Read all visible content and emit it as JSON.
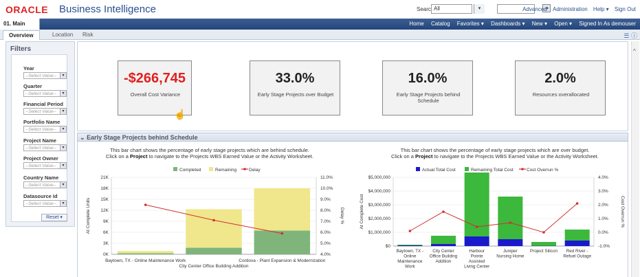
{
  "header": {
    "brand": "ORACLE",
    "product": "Business Intelligence",
    "search_label": "Search",
    "search_scope": "All",
    "links": [
      "Advanced",
      "Administration",
      "Help ▾",
      "Sign Out"
    ]
  },
  "nav": {
    "tab": "01. Main",
    "links": [
      "Home",
      "Catalog",
      "Favorites ▾",
      "Dashboards ▾",
      "New ▾",
      "Open ▾",
      "Signed In As demouser"
    ]
  },
  "subtabs": [
    "Overview",
    "Location",
    "Risk"
  ],
  "filters": {
    "title": "Filters",
    "placeholder": "--Select Value--",
    "items": [
      "Year",
      "Quarter",
      "Financial Period",
      "Portfolio Name",
      "Project Name",
      "Project Owner",
      "Country Name",
      "Datasource Id"
    ],
    "reset_label": "Reset ▾"
  },
  "kpis": [
    {
      "value": "-$266,745",
      "label": "Overall Cost Variance"
    },
    {
      "value": "33.0%",
      "label": "Early Stage Projects over Budget"
    },
    {
      "value": "16.0%",
      "label": "Early Stage Projects behind Schedule"
    },
    {
      "value": "2.0%",
      "label": "Resources overallocated"
    }
  ],
  "section_title": "Early Stage Projects behind Schedule",
  "left_desc": {
    "line1": "This bar chart shows the percentage of early stage projects which are behind schedule.",
    "line2_pre": "Click on a ",
    "line2_bold": "Project",
    "line2_post": " to navigate to the Projects WBS Earned Value or the Activity Worksheet."
  },
  "right_desc": {
    "line1": "This bar chart shows the percentage of early stage projects which are over budget.",
    "line2_pre": "Click on a ",
    "line2_bold": "Project",
    "line2_post": " to navigate to the Projects WBS Earned Value or the Activity Worksheet."
  },
  "colors": {
    "completed": "#7fb57a",
    "remaining": "#f0e68c",
    "delay": "#d03030",
    "actual": "#1a1acc",
    "remaining_cost": "#3cb83c",
    "overrun": "#d03030",
    "kpi_red": "#e02020"
  },
  "chart_data": [
    {
      "type": "bar",
      "stacked": true,
      "categories": [
        "Baytown, TX - Online Maintenance Work",
        "City Center Office Building Addition",
        "Cordova - Plant Expansion & Modernization"
      ],
      "series": [
        {
          "name": "Completed",
          "values": [
            300,
            1800,
            6500
          ]
        },
        {
          "name": "Remaining",
          "values": [
            600,
            10500,
            11500
          ]
        },
        {
          "name": "Delay",
          "axis": "right",
          "values": [
            8.5,
            7.1,
            5.9
          ]
        }
      ],
      "ylabel": "At Complete Units",
      "y2label": "Delay %",
      "ylim": [
        0,
        21000
      ],
      "y2lim": [
        4.0,
        11.0
      ],
      "yticks": [
        "21K",
        "18K",
        "15K",
        "12K",
        "9K",
        "6K",
        "3K",
        "0K"
      ],
      "y2ticks": [
        "11.0%",
        "10.0%",
        "9.0%",
        "8.0%",
        "7.0%",
        "6.0%",
        "5.0%",
        "4.0%"
      ],
      "legend": [
        "Completed",
        "Remaining",
        "Delay"
      ]
    },
    {
      "type": "bar",
      "stacked": true,
      "categories": [
        "Baytown, TX - Online Maintenance Work",
        "City Center Office Building Addition",
        "Harbour Pointe Assisted Living Center",
        "Juniper Nursing Home",
        "Project Silicon",
        "Red River - Refuel Outage"
      ],
      "series": [
        {
          "name": "Actual Total Cost",
          "values": [
            50000,
            150000,
            700000,
            500000,
            20000,
            400000
          ]
        },
        {
          "name": "Remaining Total Cost",
          "values": [
            50000,
            600000,
            4650000,
            3100000,
            280000,
            800000
          ]
        },
        {
          "name": "Cost Overrun %",
          "axis": "right",
          "values": [
            0.1,
            1.5,
            0.4,
            0.7,
            0.0,
            2.1
          ]
        }
      ],
      "ylabel": "At Complete Cost",
      "y2label": "Cost Overrun %",
      "ylim": [
        0,
        5000000
      ],
      "y2lim": [
        -1.0,
        4.0
      ],
      "yticks": [
        "$5,000,000",
        "$4,000,000",
        "$3,000,000",
        "$2,000,000",
        "$1,000,000",
        "$0"
      ],
      "y2ticks": [
        "4.0%",
        "3.0%",
        "2.0%",
        "1.0%",
        "0.0%",
        "-1.0%"
      ],
      "legend": [
        "Actual Total Cost",
        "Remaining Total Cost",
        "Cost Overrun %"
      ]
    }
  ]
}
